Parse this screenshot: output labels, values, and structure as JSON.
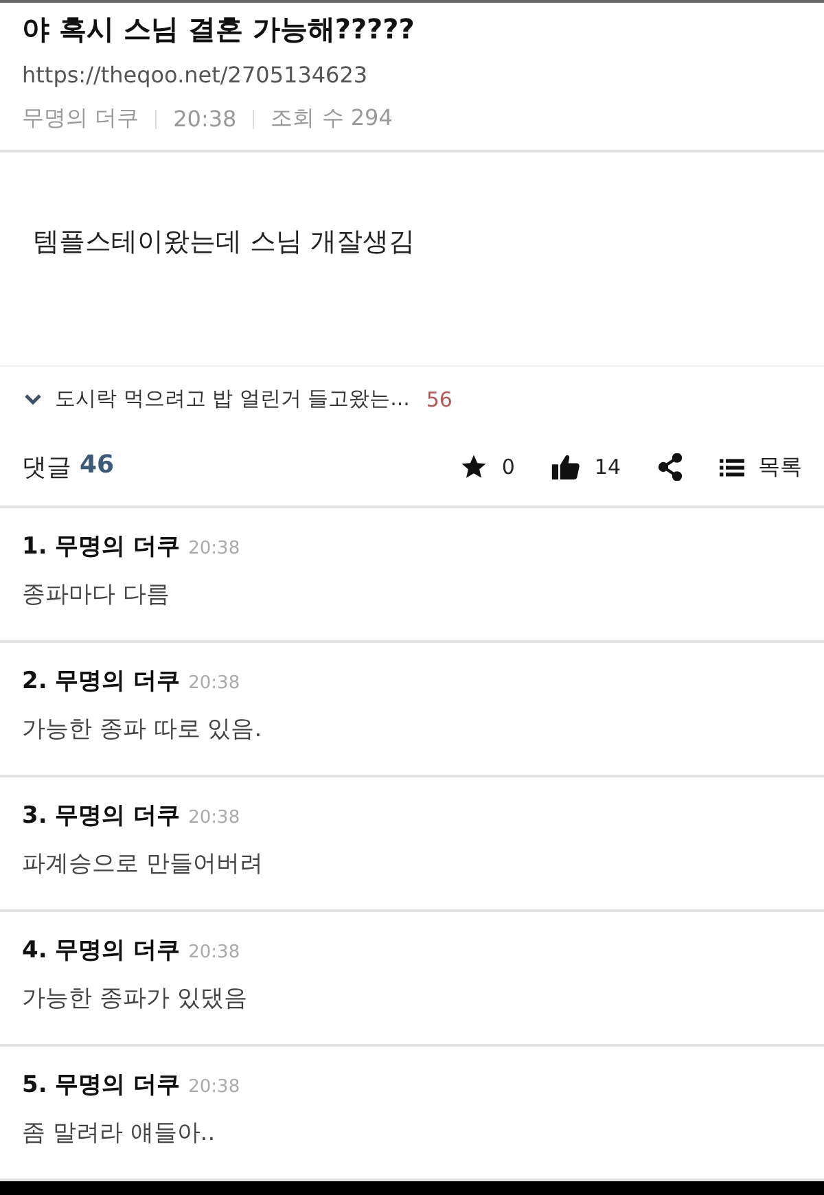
{
  "post": {
    "title": "야 혹시 스님 결혼 가능해?????",
    "url": "https://theqoo.net/2705134623",
    "author": "무명의 더쿠",
    "time": "20:38",
    "views": "조회 수 294",
    "body": "템플스테이왔는데 스님 개잘생김"
  },
  "related": {
    "expanded": false,
    "title": "도시락 먹으려고 밥 얼린거 들고왔는...",
    "count": "56"
  },
  "actions": {
    "comments_label": "댓글",
    "comments_count": "46",
    "star_count": "0",
    "like_count": "14",
    "list_label": "목록"
  },
  "comments": [
    {
      "number": "1.",
      "author": "무명의 더쿠",
      "time": "20:38",
      "text": "종파마다 다름"
    },
    {
      "number": "2.",
      "author": "무명의 더쿠",
      "time": "20:38",
      "text": "가능한 종파 따로 있음."
    },
    {
      "number": "3.",
      "author": "무명의 더쿠",
      "time": "20:38",
      "text": "파계승으로 만들어버려"
    },
    {
      "number": "4.",
      "author": "무명의 더쿠",
      "time": "20:38",
      "text": "가능한 종파가 있댔음"
    },
    {
      "number": "5.",
      "author": "무명의 더쿠",
      "time": "20:38",
      "text": "좀 말려라 얘들아.."
    }
  ]
}
